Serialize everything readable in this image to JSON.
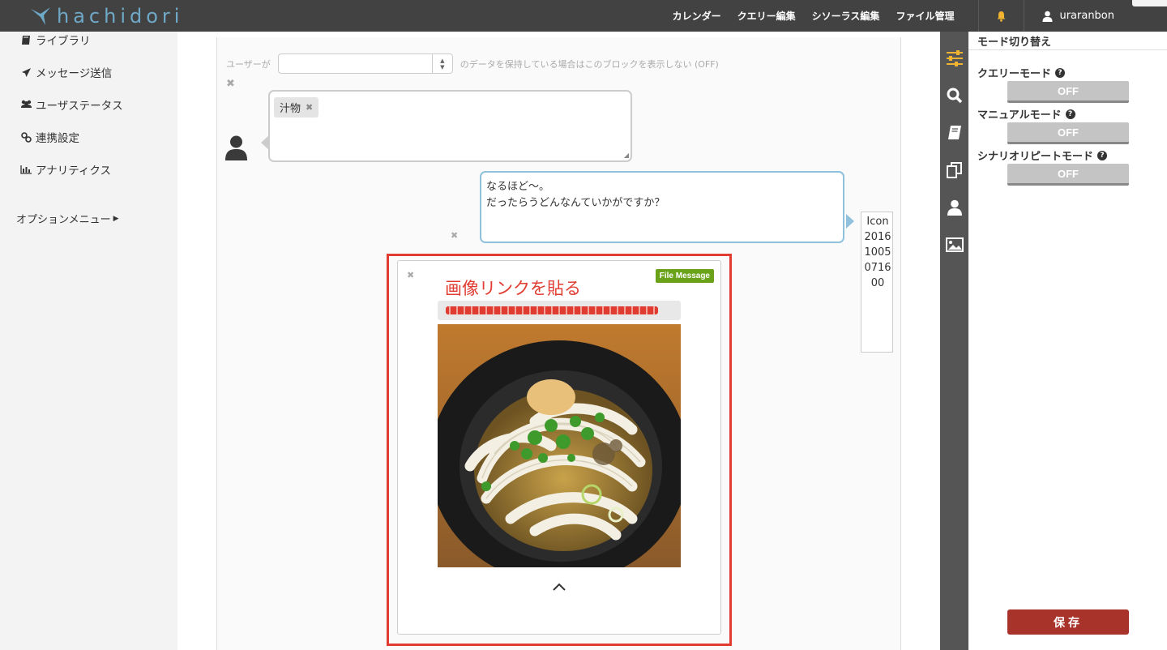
{
  "app": {
    "logo_text": "hachidori"
  },
  "topnav": {
    "items": [
      "カレンダー",
      "クエリー編集",
      "シソーラス編集",
      "ファイル管理"
    ],
    "username": "uraranbon"
  },
  "sidebar": {
    "items": [
      {
        "label": "ライブラリ",
        "icon": "book-icon"
      },
      {
        "label": "メッセージ送信",
        "icon": "send-icon"
      },
      {
        "label": "ユーザステータス",
        "icon": "users-icon"
      },
      {
        "label": "連携設定",
        "icon": "link-icon"
      },
      {
        "label": "アナリティクス",
        "icon": "bar-chart-icon"
      }
    ],
    "option_menu": "オプションメニュー"
  },
  "condition": {
    "prefix": "ユーザーが",
    "select_value": "",
    "suffix": "のデータを保持している場合はこのブロックを表示しない (OFF)"
  },
  "user_block": {
    "tag": "汁物"
  },
  "reply_block": {
    "line1": "なるほど〜。",
    "line2": "だったらうどんなんていかがですか？"
  },
  "bot_icon_alt": "Icon 20161005071600",
  "file_message": {
    "badge": "File Message",
    "annotation": "画像リンクを貼る"
  },
  "tools": [
    "sliders-icon",
    "search-icon",
    "book-icon",
    "copy-icon",
    "user-icon",
    "image-icon"
  ],
  "right_panel": {
    "title": "モード切り替え",
    "modes": [
      {
        "label": "クエリーモード",
        "state": "OFF"
      },
      {
        "label": "マニュアルモード",
        "state": "OFF"
      },
      {
        "label": "シナリオリピートモード",
        "state": "OFF"
      }
    ],
    "save_label": "保存"
  },
  "colors": {
    "accent_red": "#e03c31",
    "save_red": "#a8332b",
    "topbar": "#424242",
    "badge_green": "#6aa31a",
    "bubble_blue": "#8fc1dc"
  }
}
